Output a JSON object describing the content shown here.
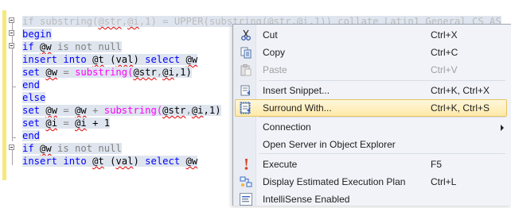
{
  "editor": {
    "lines": [
      {
        "id": "l1",
        "parts": [
          {
            "t": "if ",
            "c": "kw"
          },
          {
            "t": "substring(",
            "c": "fn"
          },
          {
            "t": "@str",
            "c": "var"
          },
          {
            "t": ",",
            "c": "gr"
          },
          {
            "t": "@i",
            "c": "var"
          },
          {
            "t": ",1) = ",
            "c": ""
          },
          {
            "t": "UPPER(",
            "c": "fn"
          },
          {
            "t": "substring(@str,@i,1)) collate Latin1_General_CS_AS",
            "c": ""
          }
        ]
      },
      {
        "id": "l2",
        "parts": [
          {
            "t": "begin",
            "c": "kw"
          }
        ]
      },
      {
        "id": "l3",
        "parts": [
          {
            "t": "if ",
            "c": "kw"
          },
          {
            "t": "@w",
            "c": "var"
          },
          {
            "t": " is not null",
            "c": "gr"
          }
        ]
      },
      {
        "id": "l4",
        "parts": [
          {
            "t": "insert into ",
            "c": "kw"
          },
          {
            "t": "@t",
            "c": "var"
          },
          {
            "t": " (",
            "c": ""
          },
          {
            "t": "val",
            "c": "var"
          },
          {
            "t": ") ",
            "c": ""
          },
          {
            "t": "select ",
            "c": "kw"
          },
          {
            "t": "@w",
            "c": "var"
          }
        ]
      },
      {
        "id": "l5",
        "parts": [
          {
            "t": "set ",
            "c": "kw"
          },
          {
            "t": "@w",
            "c": "var"
          },
          {
            "t": " = ",
            "c": "gr"
          },
          {
            "t": "substring(",
            "c": "fn"
          },
          {
            "t": "@str",
            "c": "var"
          },
          {
            "t": ",",
            "c": "gr"
          },
          {
            "t": "@i",
            "c": "var"
          },
          {
            "t": ",1)",
            "c": ""
          }
        ]
      },
      {
        "id": "l6",
        "parts": [
          {
            "t": "end",
            "c": "kw"
          }
        ]
      },
      {
        "id": "l7",
        "parts": [
          {
            "t": "else",
            "c": "kw"
          }
        ]
      },
      {
        "id": "l8",
        "parts": [
          {
            "t": "set ",
            "c": "kw"
          },
          {
            "t": "@w",
            "c": "var"
          },
          {
            "t": " = ",
            "c": "gr"
          },
          {
            "t": "@w",
            "c": "var"
          },
          {
            "t": " + ",
            "c": "gr"
          },
          {
            "t": "substring(",
            "c": "fn"
          },
          {
            "t": "@str",
            "c": "var"
          },
          {
            "t": ",",
            "c": "gr"
          },
          {
            "t": "@i",
            "c": "var"
          },
          {
            "t": ",1)",
            "c": ""
          }
        ]
      },
      {
        "id": "l9",
        "parts": [
          {
            "t": "set ",
            "c": "kw"
          },
          {
            "t": "@i",
            "c": "var"
          },
          {
            "t": " = ",
            "c": "gr"
          },
          {
            "t": "@i",
            "c": "var"
          },
          {
            "t": " + 1",
            "c": ""
          }
        ]
      },
      {
        "id": "l10",
        "parts": [
          {
            "t": "end",
            "c": "kw"
          }
        ]
      },
      {
        "id": "l11",
        "parts": [
          {
            "t": "if ",
            "c": "kw"
          },
          {
            "t": "@w",
            "c": "var"
          },
          {
            "t": " is not null",
            "c": "gr"
          }
        ]
      },
      {
        "id": "l12",
        "parts": [
          {
            "t": "insert into ",
            "c": "kw"
          },
          {
            "t": "@t",
            "c": "var"
          },
          {
            "t": " (",
            "c": ""
          },
          {
            "t": "val",
            "c": "var"
          },
          {
            "t": ") ",
            "c": ""
          },
          {
            "t": "select ",
            "c": "kw"
          },
          {
            "t": "@w",
            "c": "var"
          }
        ]
      }
    ]
  },
  "context_menu": {
    "items": [
      {
        "name": "cut",
        "label": "Cut",
        "shortcut": "Ctrl+X",
        "icon": "scissors-icon",
        "enabled": true
      },
      {
        "name": "copy",
        "label": "Copy",
        "shortcut": "Ctrl+C",
        "icon": "copy-icon",
        "enabled": true
      },
      {
        "name": "paste",
        "label": "Paste",
        "shortcut": "Ctrl+V",
        "icon": "paste-icon",
        "enabled": false
      },
      {
        "name": "insert-snippet",
        "label": "Insert Snippet...",
        "shortcut": "Ctrl+K, Ctrl+X",
        "icon": "snippet-icon",
        "enabled": true
      },
      {
        "name": "surround-with",
        "label": "Surround With...",
        "shortcut": "Ctrl+K, Ctrl+S",
        "icon": "surround-icon",
        "enabled": true,
        "highlighted": true
      },
      {
        "name": "connection",
        "label": "Connection",
        "shortcut": "",
        "icon": "",
        "enabled": true,
        "submenu": true
      },
      {
        "name": "open-server",
        "label": "Open Server in Object Explorer",
        "shortcut": "",
        "icon": "",
        "enabled": true
      },
      {
        "name": "execute",
        "label": "Execute",
        "shortcut": "F5",
        "icon": "execute-icon",
        "enabled": true
      },
      {
        "name": "display-plan",
        "label": "Display Estimated Execution Plan",
        "shortcut": "Ctrl+L",
        "icon": "execution-plan-icon",
        "enabled": true
      },
      {
        "name": "intellisense",
        "label": "IntelliSense Enabled",
        "shortcut": "",
        "icon": "intellisense-icon",
        "enabled": true
      }
    ]
  },
  "colors": {
    "keyword": "#0000ff",
    "function": "#ff00ff",
    "operator": "#808080",
    "selection": "#dfe5ef",
    "change_bar": "#f5e97a",
    "menu_highlight": "#ffe9a8"
  }
}
